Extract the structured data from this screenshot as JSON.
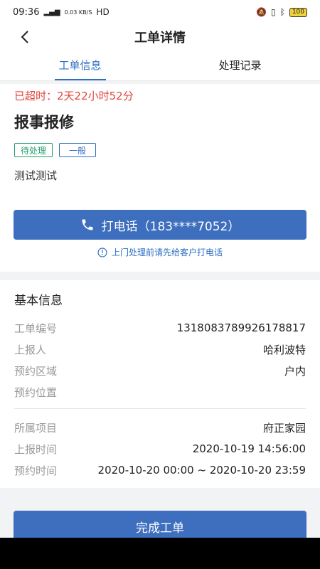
{
  "status_bar": {
    "time": "09:36",
    "network_speed": "0.03 KB/S",
    "network_type": "HD",
    "battery": "100"
  },
  "nav": {
    "title": "工单详情"
  },
  "tabs": [
    {
      "label": "工单信息",
      "active": true
    },
    {
      "label": "处理记录",
      "active": false
    }
  ],
  "ticket": {
    "overtime": "已超时：2天22小时52分",
    "title": "报事报修",
    "status_badge": "待处理",
    "level_badge": "一般",
    "description": "测试测试",
    "call_button": "打电话（183****7052）",
    "hint": "上门处理前请先给客户打电话"
  },
  "basic_info": {
    "section_title": "基本信息",
    "rows": [
      {
        "label": "工单编号",
        "value": "1318083789926178817"
      },
      {
        "label": "上报人",
        "value": "哈利波特"
      },
      {
        "label": "预约区域",
        "value": "户内"
      },
      {
        "label": "预约位置",
        "value": ""
      },
      {
        "label": "所属项目",
        "value": "府正家园"
      },
      {
        "label": "上报时间",
        "value": "2020-10-19 14:56:00"
      },
      {
        "label": "预约时间",
        "value": "2020-10-20 00:00 ~ 2020-10-20 23:59"
      }
    ]
  },
  "footer": {
    "complete_button": "完成工单"
  },
  "colors": {
    "primary": "#3d6fbe",
    "accent_text": "#2f6fc1",
    "overtime": "#e0463c",
    "status_green": "#1f9e6d"
  }
}
